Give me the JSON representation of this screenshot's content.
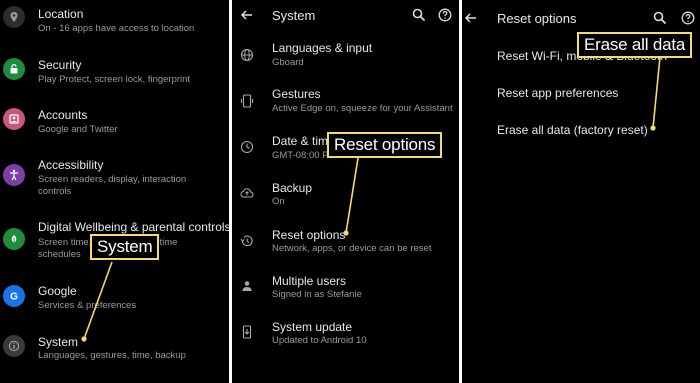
{
  "colors": {
    "callout_border": "#f3dd68",
    "panel_bg": "#000000"
  },
  "left_panel": {
    "items": [
      {
        "title": "Location",
        "sub": "On - 16 apps have access to location",
        "icon": "location-icon",
        "color": "#2d2d2d"
      },
      {
        "title": "Security",
        "sub": "Play Protect, screen lock, fingerprint",
        "icon": "lock-icon",
        "color": "#1e8e3e"
      },
      {
        "title": "Accounts",
        "sub": "Google and Twitter",
        "icon": "account-icon",
        "color": "#c45a7c"
      },
      {
        "title": "Accessibility",
        "sub": "Screen readers, display, interaction",
        "sub2": "controls",
        "icon": "accessibility-icon",
        "color": "#7b3fa8"
      },
      {
        "title": "Digital Wellbeing & parental controls",
        "sub": "Screen time, app timers, bedtime",
        "sub2": "schedules",
        "icon": "wellbeing-icon",
        "color": "#1e8e3e"
      },
      {
        "title": "Google",
        "sub": "Services & preferences",
        "icon": "google-icon",
        "color": "#1a73e8"
      },
      {
        "title": "System",
        "sub": "Languages, gestures, time, backup",
        "icon": "info-icon",
        "color": "#3a3a3a"
      }
    ]
  },
  "middle_panel": {
    "header_title": "System",
    "items": [
      {
        "title": "Languages & input",
        "sub": "Gboard",
        "icon": "globe-icon"
      },
      {
        "title": "Gestures",
        "sub": "Active Edge on, squeeze for your Assistant",
        "icon": "gesture-icon"
      },
      {
        "title": "Date & time",
        "sub": "GMT-08:00 Pacific Standard Time",
        "icon": "clock-icon"
      },
      {
        "title": "Backup",
        "sub": "On",
        "icon": "backup-icon"
      },
      {
        "title": "Reset options",
        "sub": "Network, apps, or device can be reset",
        "icon": "history-icon"
      },
      {
        "title": "Multiple users",
        "sub": "Signed in as Stefanie",
        "icon": "person-icon"
      },
      {
        "title": "System update",
        "sub": "Updated to Android 10",
        "icon": "system-update-icon"
      }
    ]
  },
  "right_panel": {
    "header_title": "Reset options",
    "items": [
      {
        "title": "Reset Wi-Fi, mobile & Bluetooth"
      },
      {
        "title": "Reset app preferences"
      },
      {
        "title": "Erase all data (factory reset)"
      }
    ]
  },
  "callouts": {
    "system": "System",
    "reset_options": "Reset options",
    "erase_all_data": "Erase all data"
  }
}
